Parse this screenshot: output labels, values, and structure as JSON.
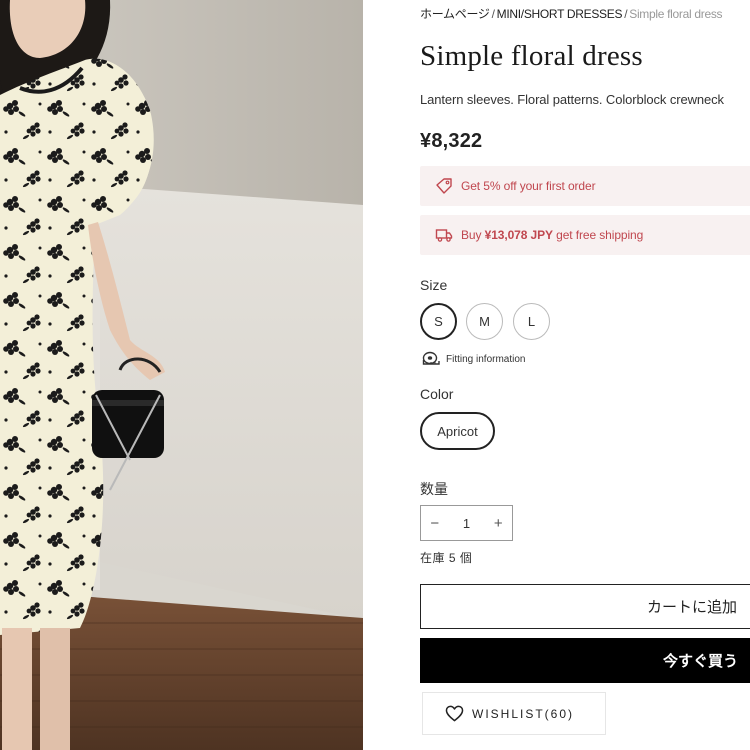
{
  "breadcrumb": {
    "home": "ホームページ",
    "category": "MINI/SHORT DRESSES",
    "current": "Simple floral dress",
    "separator": "/"
  },
  "product": {
    "title": "Simple floral dress",
    "subtitle": "Lantern sleeves. Floral patterns. Colorblock crewneck",
    "price": "¥8,322",
    "image_alt": "model wearing apricot floral dress holding a black handbag"
  },
  "promos": [
    {
      "icon": "tag-icon",
      "text": "Get 5% off your first order"
    },
    {
      "icon": "truck-icon",
      "prefix": "Buy",
      "amount": "¥13,078 JPY",
      "suffix": "get free shipping"
    }
  ],
  "size": {
    "label": "Size",
    "options": [
      "S",
      "M",
      "L"
    ],
    "selected": "S",
    "fitting_label": "Fitting information"
  },
  "color": {
    "label": "Color",
    "options": [
      "Apricot"
    ],
    "selected": "Apricot"
  },
  "quantity": {
    "label": "数量",
    "value": "1",
    "minus": "−",
    "plus": "+",
    "stock": "在庫 5 個"
  },
  "actions": {
    "add_to_cart": "カートに追加",
    "buy_now": "今すぐ買う",
    "wishlist": "WISHLIST(60)"
  },
  "colors": {
    "promo_bg": "#f8f1f1",
    "promo_text": "#c0474f",
    "primary": "#000000",
    "dress": "#f3efd8",
    "floor": "#6a4630"
  }
}
